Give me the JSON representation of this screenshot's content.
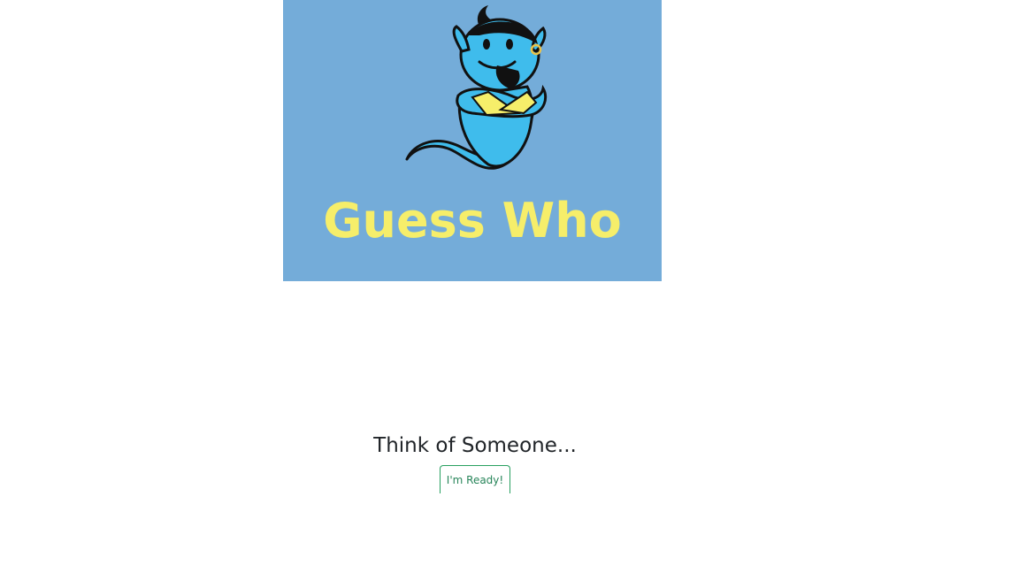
{
  "logo": {
    "title": "Guess Who",
    "mascot_icon": "genie-icon",
    "background_color": "#74acd9",
    "title_color": "#f6ee6a"
  },
  "prompt": {
    "text": "Think of Someone..."
  },
  "ready_button": {
    "label": "I'm Ready!",
    "color": "#28855a"
  }
}
